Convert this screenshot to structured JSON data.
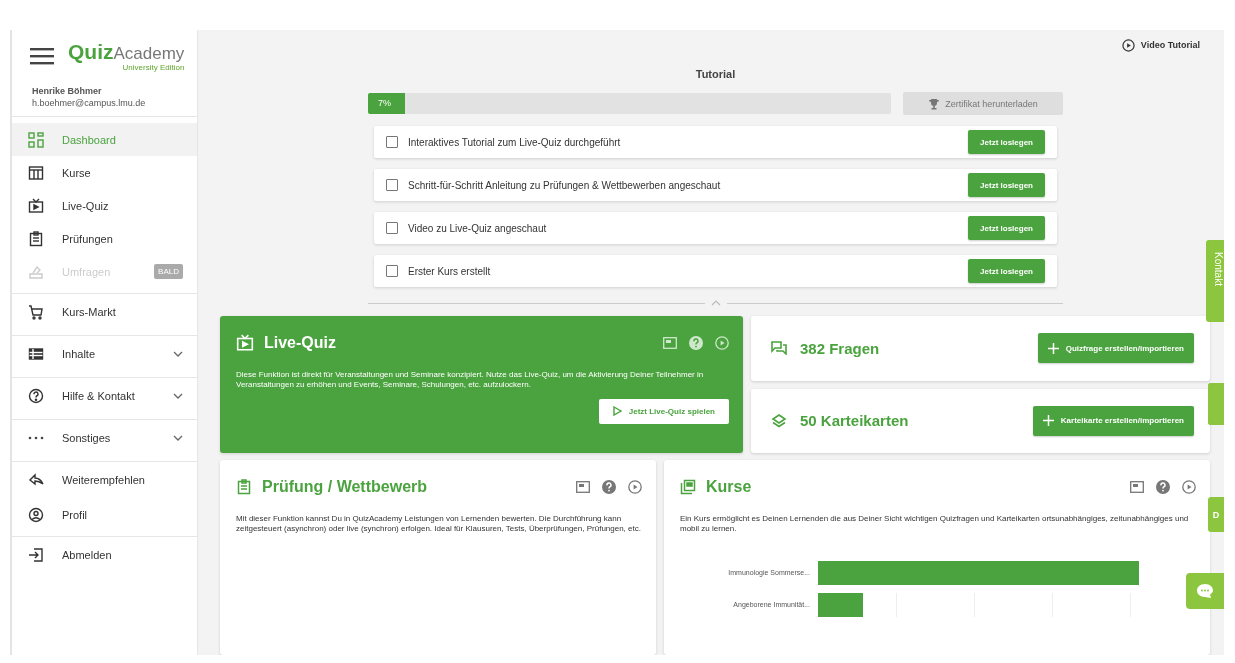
{
  "logo": {
    "brand_bold": "Quiz",
    "brand_light": "Academy",
    "edition": "University Edition"
  },
  "user": {
    "name": "Henrike Böhmer",
    "email": "h.boehmer@campus.lmu.de"
  },
  "sidebar": {
    "items": [
      {
        "label": "Dashboard",
        "kind": "link",
        "selected": true,
        "disabled": false,
        "divider_before": false
      },
      {
        "label": "Kurse",
        "kind": "link",
        "selected": false,
        "disabled": false,
        "divider_before": false
      },
      {
        "label": "Live-Quiz",
        "kind": "link",
        "selected": false,
        "disabled": false,
        "divider_before": false
      },
      {
        "label": "Prüfungen",
        "kind": "link",
        "selected": false,
        "disabled": false,
        "divider_before": false
      },
      {
        "label": "Umfragen",
        "kind": "link",
        "selected": false,
        "disabled": true,
        "divider_before": false,
        "badge": "BALD"
      },
      {
        "label": "Kurs-Markt",
        "kind": "link",
        "selected": false,
        "disabled": false,
        "divider_before": true
      },
      {
        "label": "Inhalte",
        "kind": "group",
        "selected": false,
        "disabled": false,
        "divider_before": true
      },
      {
        "label": "Hilfe & Kontakt",
        "kind": "group",
        "selected": false,
        "disabled": false,
        "divider_before": true
      },
      {
        "label": "Sonstiges",
        "kind": "group",
        "selected": false,
        "disabled": false,
        "divider_before": true
      },
      {
        "label": "Weiterempfehlen",
        "kind": "link",
        "selected": false,
        "disabled": false,
        "divider_before": true
      },
      {
        "label": "Profil",
        "kind": "link",
        "selected": false,
        "disabled": false,
        "divider_before": false
      },
      {
        "label": "Abmelden",
        "kind": "link",
        "selected": false,
        "disabled": false,
        "divider_before": true
      }
    ]
  },
  "video_tutorial": "Video Tutorial",
  "tutorial": {
    "title": "Tutorial",
    "progress": {
      "level": 0.07,
      "reading": "7%"
    },
    "certificate_button": {
      "label": "Zertifikat herunterladen",
      "disabled": true
    },
    "tasks": [
      {
        "label": "Interaktives Tutorial zum Live-Quiz durchgeführt",
        "checked": false,
        "button": "Jetzt loslegen"
      },
      {
        "label": "Schritt-für-Schritt Anleitung zu Prüfungen & Wettbewerben angeschaut",
        "checked": false,
        "button": "Jetzt loslegen"
      },
      {
        "label": "Video zu Live-Quiz angeschaut",
        "checked": false,
        "button": "Jetzt loslegen"
      },
      {
        "label": "Erster Kurs erstellt",
        "checked": false,
        "button": "Jetzt loslegen"
      }
    ]
  },
  "live_quiz": {
    "title": "Live-Quiz",
    "text": "Diese Funktion ist direkt für Veranstaltungen und Seminare konzipiert. Nutze das Live-Quiz, um die Aktivierung Deiner Teilnehmer in Veranstaltungen zu erhöhen und Events, Seminare, Schulungen, etc. aufzulockern.",
    "button": "Jetzt Live-Quiz spielen"
  },
  "counters": [
    {
      "label": "382 Fragen",
      "button": "Quizfrage erstellen/importieren"
    },
    {
      "label": "50 Karteikarten",
      "button": "Karteikarte erstellen/importieren"
    }
  ],
  "exam": {
    "title": "Prüfung / Wettbewerb",
    "text": "Mit dieser Funktion kannst Du in QuizAcademy Leistungen von Lernenden bewerten. Die Durchführung kann zeitgesteuert (asynchron) oder live (synchron) erfolgen. Ideal für Klausuren, Tests, Überprüfungen, Prüfungen, etc."
  },
  "courses": {
    "title": "Kurse",
    "text": "Ein Kurs ermöglicht es Deinen Lernenden die aus Deiner Sicht wichtigen Quizfragen und Karteikarten ortsunabhängiges, zeitunabhängiges und mobil zu lernen.",
    "bars": [
      "Immunologie Sommerse...",
      "Angeborene Immunität..."
    ]
  },
  "side_tabs": {
    "contact": "Kontakt",
    "second": "D"
  }
}
